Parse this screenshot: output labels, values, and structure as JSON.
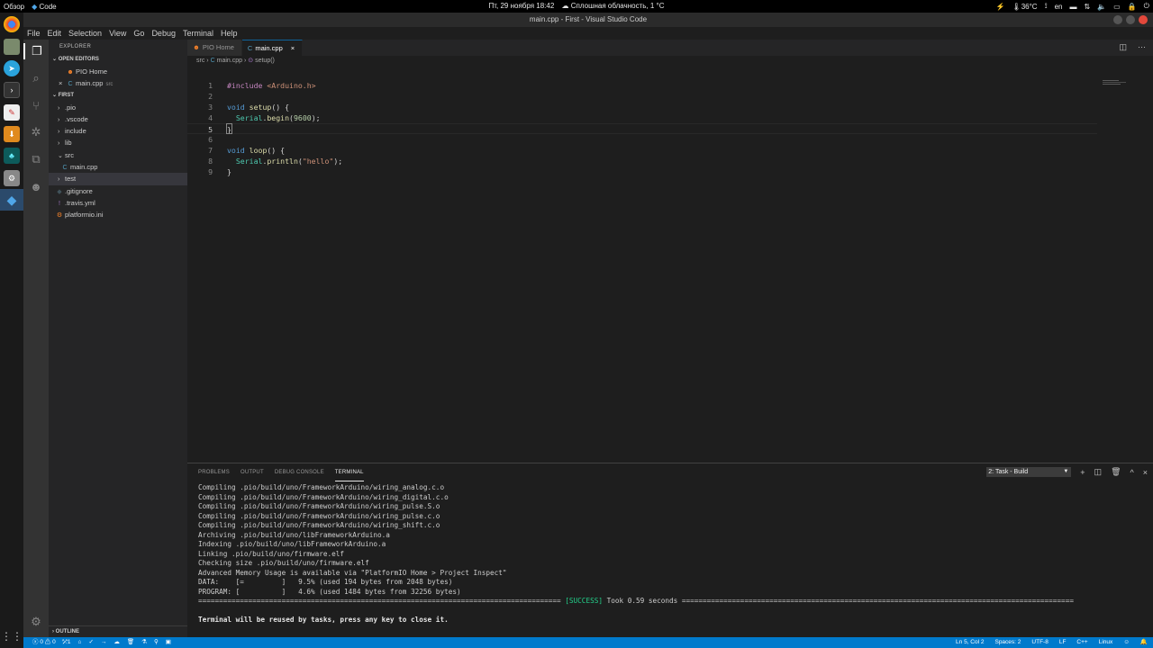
{
  "topbar": {
    "overview": "Обзор",
    "app": "Code",
    "datetime": "Пт, 29 ноября  18:42",
    "weather": "Сплошная облачность, 1 °C",
    "temp": "36°C",
    "lang": "en"
  },
  "window": {
    "title": "main.cpp - First - Visual Studio Code"
  },
  "menu": [
    "File",
    "Edit",
    "Selection",
    "View",
    "Go",
    "Debug",
    "Terminal",
    "Help"
  ],
  "sidebar": {
    "title": "EXPLORER",
    "open_editors_label": "OPEN EDITORS",
    "open_editors": [
      {
        "name": "PIO Home",
        "hint": ""
      },
      {
        "name": "main.cpp",
        "hint": "src"
      }
    ],
    "project_label": "FIRST",
    "tree": [
      {
        "name": ".pio",
        "kind": "folder"
      },
      {
        "name": ".vscode",
        "kind": "folder"
      },
      {
        "name": "include",
        "kind": "folder"
      },
      {
        "name": "lib",
        "kind": "folder"
      },
      {
        "name": "src",
        "kind": "folder-open"
      },
      {
        "name": "main.cpp",
        "kind": "file"
      },
      {
        "name": "test",
        "kind": "folder"
      },
      {
        "name": ".gitignore",
        "kind": "file"
      },
      {
        "name": ".travis.yml",
        "kind": "file"
      },
      {
        "name": "platformio.ini",
        "kind": "file"
      }
    ],
    "outline_label": "OUTLINE"
  },
  "tabs": [
    {
      "label": "PIO Home",
      "active": false
    },
    {
      "label": "main.cpp",
      "active": true,
      "close": "×"
    }
  ],
  "breadcrumb": {
    "folder": "src",
    "file": "main.cpp",
    "symbol": "setup()",
    "sep": "›"
  },
  "code": {
    "lines": [
      "1",
      "2",
      "3",
      "4",
      "5",
      "6",
      "7",
      "8",
      "9"
    ],
    "l1_pp": "#include",
    "l1_inc": " <Arduino.h>",
    "kw_void": "void",
    "fn_setup": "setup",
    "l3_rest": "() {",
    "cls_serial": "Serial",
    "fn_begin": "begin",
    "num_9600": "9600",
    "l5": "}",
    "fn_loop": "loop",
    "l7_rest": "() {",
    "fn_println": "println",
    "str_hello": "\"hello\"",
    "l9": "}"
  },
  "panel": {
    "tabs": [
      "PROBLEMS",
      "OUTPUT",
      "DEBUG CONSOLE",
      "TERMINAL"
    ],
    "task": "2: Task - Build",
    "terminal": [
      "Compiling .pio/build/uno/FrameworkArduino/wiring_analog.c.o",
      "Compiling .pio/build/uno/FrameworkArduino/wiring_digital.c.o",
      "Compiling .pio/build/uno/FrameworkArduino/wiring_pulse.S.o",
      "Compiling .pio/build/uno/FrameworkArduino/wiring_pulse.c.o",
      "Compiling .pio/build/uno/FrameworkArduino/wiring_shift.c.o",
      "Archiving .pio/build/uno/libFrameworkArduino.a",
      "Indexing .pio/build/uno/libFrameworkArduino.a",
      "Linking .pio/build/uno/firmware.elf",
      "Checking size .pio/build/uno/firmware.elf",
      "Advanced Memory Usage is available via \"PlatformIO Home > Project Inspect\"",
      "DATA:    [=         ]   9.5% (used 194 bytes from 2048 bytes)",
      "PROGRAM: [          ]   4.6% (used 1484 bytes from 32256 bytes)"
    ],
    "success_left": "======================================================================================= ",
    "success_word": "[SUCCESS]",
    "success_right": " Took 0.59 seconds ==============================================================================================",
    "reuse_msg": "Terminal will be reused by tasks, press any key to close it."
  },
  "status": {
    "errors": "0",
    "warnings": "0",
    "sync": "1",
    "position": "Ln 5, Col 2",
    "spaces": "Spaces: 2",
    "encoding": "UTF-8",
    "eol": "LF",
    "language": "C++",
    "os": "Linux"
  },
  "colors": {
    "accent": "#007acc",
    "success": "#23d18b",
    "keyword": "#569cd6",
    "function": "#dcdcaa",
    "number": "#b5cea8",
    "string": "#ce9178"
  }
}
